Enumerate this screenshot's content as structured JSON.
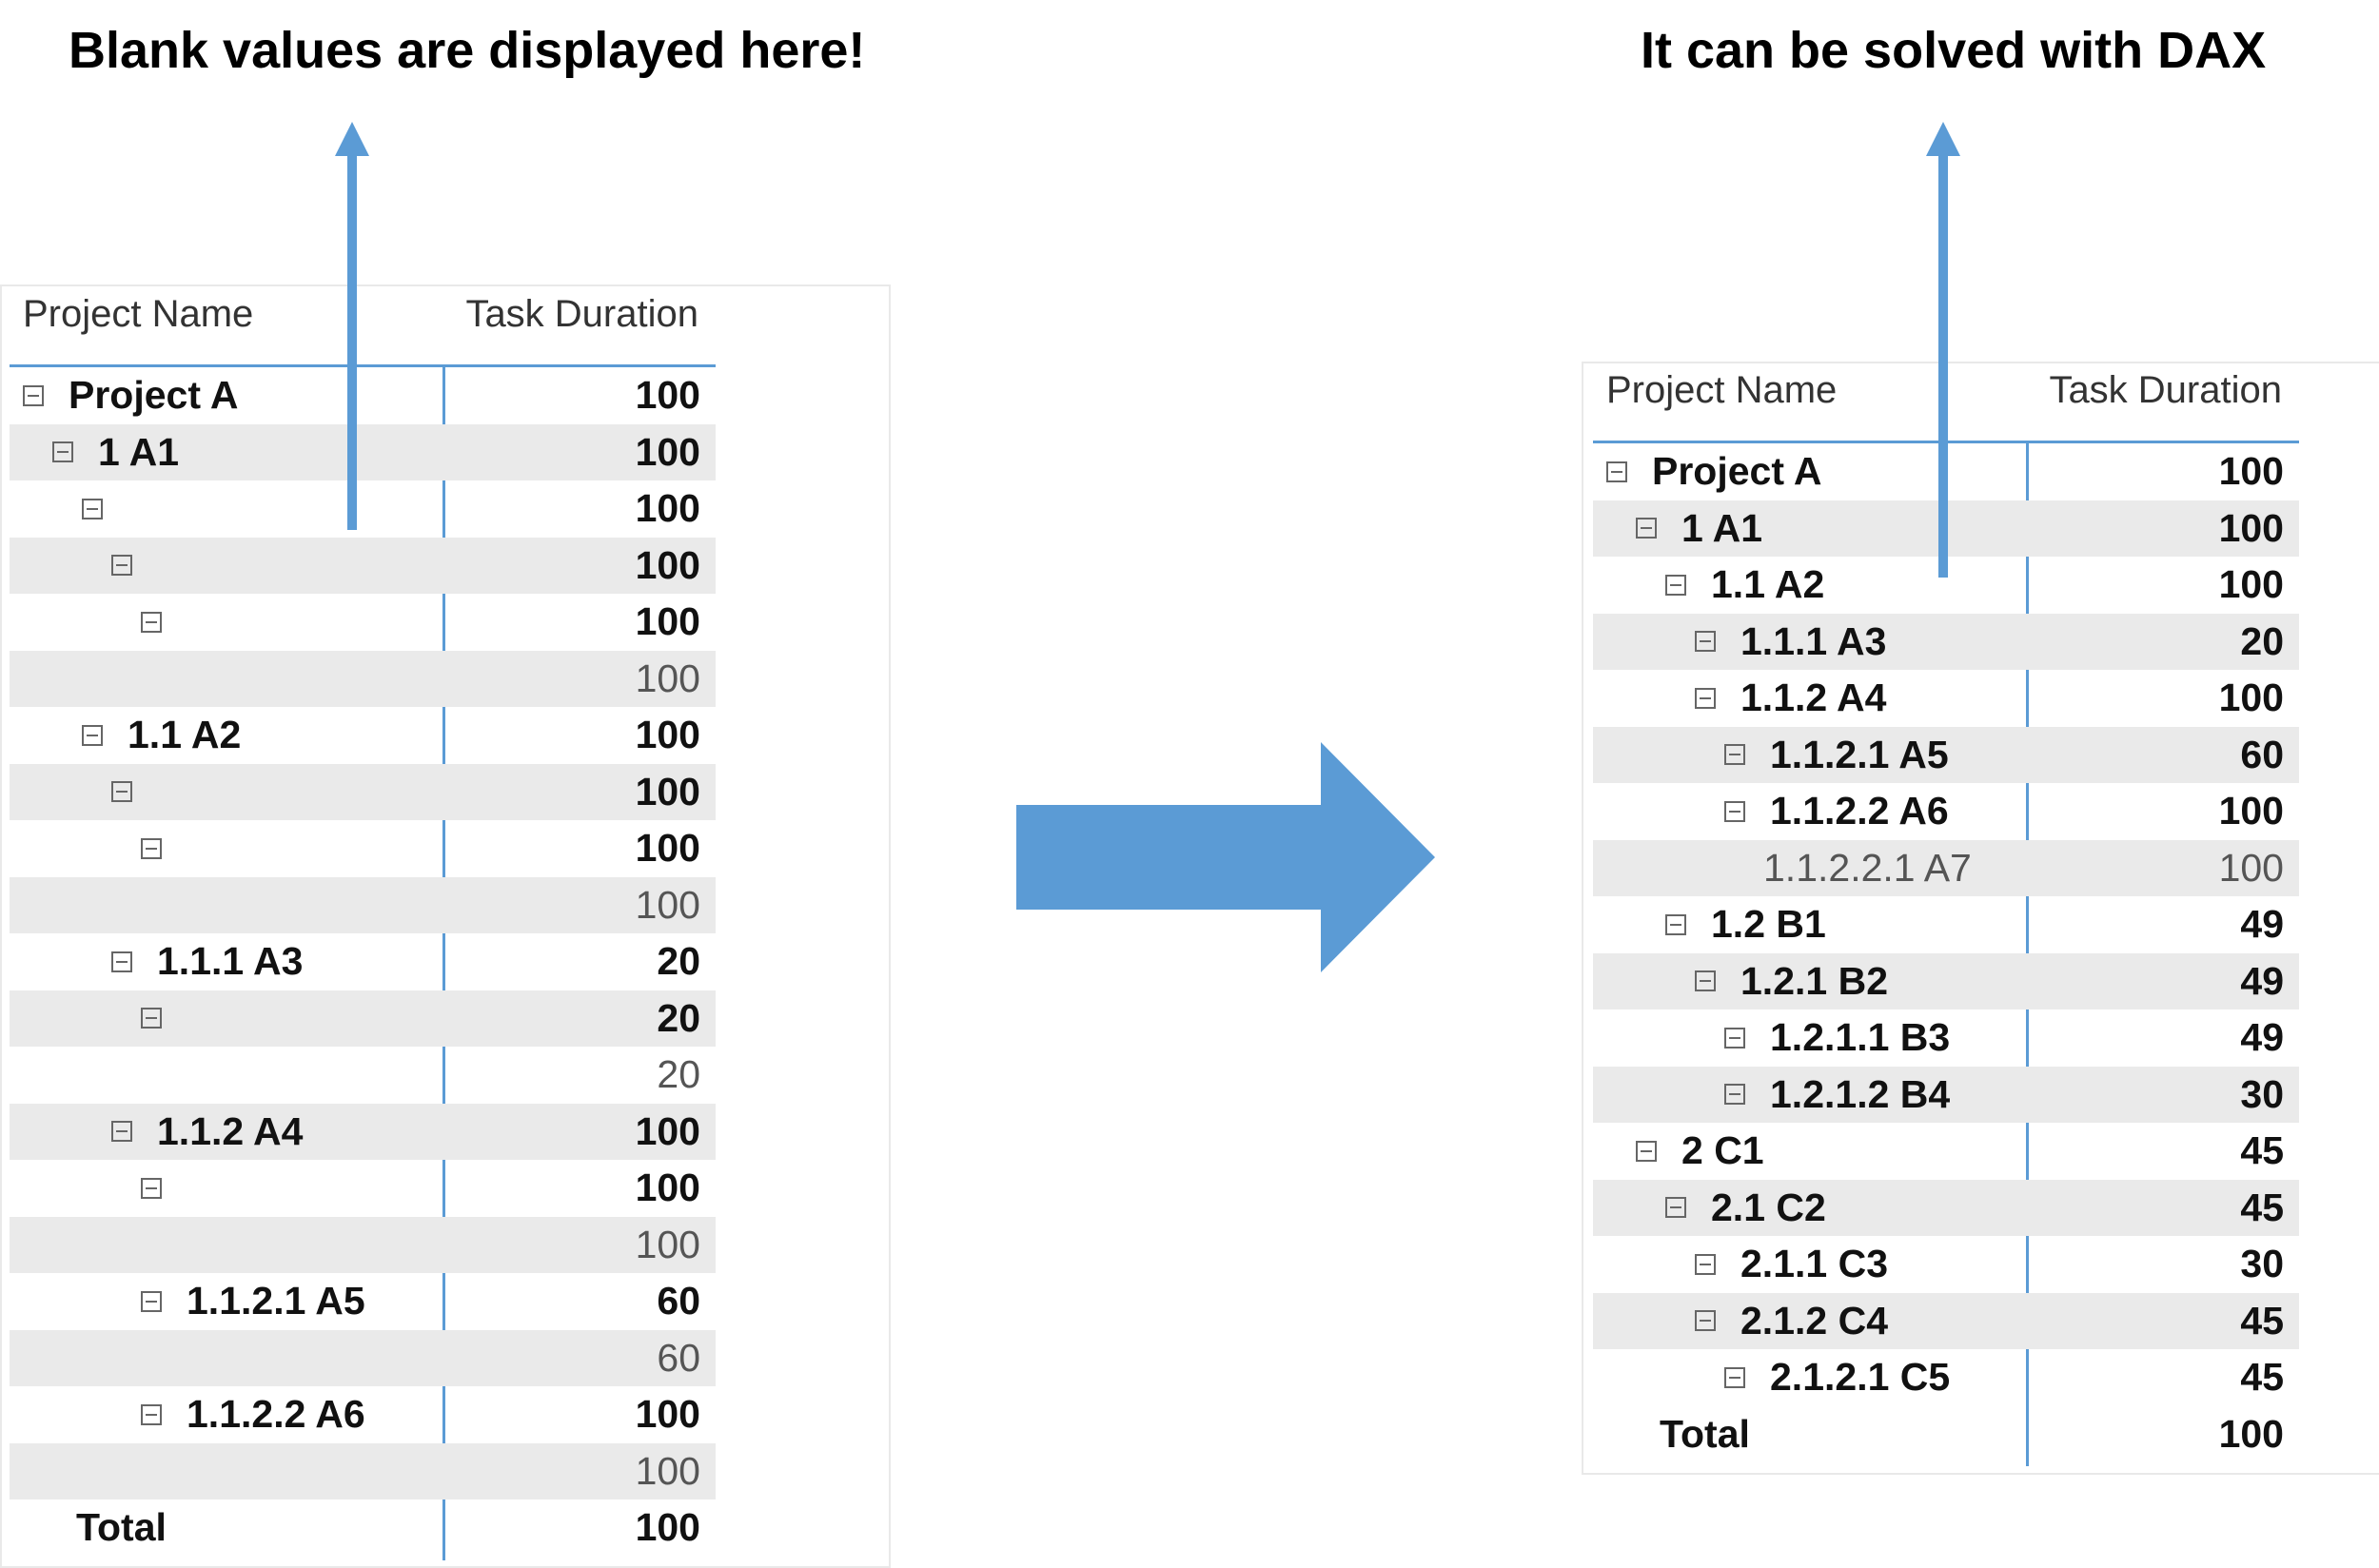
{
  "captions": {
    "left": "Blank values are displayed here!",
    "right": "It can be solved with DAX"
  },
  "colors": {
    "accent": "#5b9bd5",
    "band": "#eaeaea"
  },
  "left_matrix": {
    "col_name": "Project Name",
    "col_value": "Task Duration",
    "rows": [
      {
        "label": "Project A",
        "value": "100",
        "level": 0,
        "toggle": true,
        "bold": true
      },
      {
        "label": "1 A1",
        "value": "100",
        "level": 1,
        "toggle": true,
        "bold": true
      },
      {
        "label": "",
        "value": "100",
        "level": 2,
        "toggle": true,
        "bold": true
      },
      {
        "label": "",
        "value": "100",
        "level": 3,
        "toggle": true,
        "bold": true
      },
      {
        "label": "",
        "value": "100",
        "level": 4,
        "toggle": true,
        "bold": true
      },
      {
        "label": "",
        "value": "100",
        "level": 5,
        "toggle": false,
        "bold": false
      },
      {
        "label": "1.1 A2",
        "value": "100",
        "level": 2,
        "toggle": true,
        "bold": true
      },
      {
        "label": "",
        "value": "100",
        "level": 3,
        "toggle": true,
        "bold": true
      },
      {
        "label": "",
        "value": "100",
        "level": 4,
        "toggle": true,
        "bold": true
      },
      {
        "label": "",
        "value": "100",
        "level": 5,
        "toggle": false,
        "bold": false
      },
      {
        "label": "1.1.1 A3",
        "value": "20",
        "level": 3,
        "toggle": true,
        "bold": true
      },
      {
        "label": "",
        "value": "20",
        "level": 4,
        "toggle": true,
        "bold": true
      },
      {
        "label": "",
        "value": "20",
        "level": 5,
        "toggle": false,
        "bold": false
      },
      {
        "label": "1.1.2 A4",
        "value": "100",
        "level": 3,
        "toggle": true,
        "bold": true
      },
      {
        "label": "",
        "value": "100",
        "level": 4,
        "toggle": true,
        "bold": true
      },
      {
        "label": "",
        "value": "100",
        "level": 5,
        "toggle": false,
        "bold": false
      },
      {
        "label": "1.1.2.1 A5",
        "value": "60",
        "level": 4,
        "toggle": true,
        "bold": true
      },
      {
        "label": "",
        "value": "60",
        "level": 5,
        "toggle": false,
        "bold": false
      },
      {
        "label": "1.1.2.2 A6",
        "value": "100",
        "level": 4,
        "toggle": true,
        "bold": true
      },
      {
        "label": "",
        "value": "100",
        "level": 5,
        "toggle": false,
        "bold": false
      }
    ],
    "total_label": "Total",
    "total_value": "100"
  },
  "right_matrix": {
    "col_name": "Project Name",
    "col_value": "Task Duration",
    "rows": [
      {
        "label": "Project A",
        "value": "100",
        "level": 0,
        "toggle": true,
        "bold": true
      },
      {
        "label": "1 A1",
        "value": "100",
        "level": 1,
        "toggle": true,
        "bold": true
      },
      {
        "label": "1.1 A2",
        "value": "100",
        "level": 2,
        "toggle": true,
        "bold": true
      },
      {
        "label": "1.1.1 A3",
        "value": "20",
        "level": 3,
        "toggle": true,
        "bold": true
      },
      {
        "label": "1.1.2 A4",
        "value": "100",
        "level": 3,
        "toggle": true,
        "bold": true
      },
      {
        "label": "1.1.2.1 A5",
        "value": "60",
        "level": 4,
        "toggle": true,
        "bold": true
      },
      {
        "label": "1.1.2.2 A6",
        "value": "100",
        "level": 4,
        "toggle": true,
        "bold": true
      },
      {
        "label": "1.1.2.2.1 A7",
        "value": "100",
        "level": 5,
        "toggle": false,
        "bold": false
      },
      {
        "label": "1.2 B1",
        "value": "49",
        "level": 2,
        "toggle": true,
        "bold": true
      },
      {
        "label": "1.2.1 B2",
        "value": "49",
        "level": 3,
        "toggle": true,
        "bold": true
      },
      {
        "label": "1.2.1.1 B3",
        "value": "49",
        "level": 4,
        "toggle": true,
        "bold": true
      },
      {
        "label": "1.2.1.2 B4",
        "value": "30",
        "level": 4,
        "toggle": true,
        "bold": true
      },
      {
        "label": "2 C1",
        "value": "45",
        "level": 1,
        "toggle": true,
        "bold": true
      },
      {
        "label": "2.1 C2",
        "value": "45",
        "level": 2,
        "toggle": true,
        "bold": true
      },
      {
        "label": "2.1.1 C3",
        "value": "30",
        "level": 3,
        "toggle": true,
        "bold": true
      },
      {
        "label": "2.1.2 C4",
        "value": "45",
        "level": 3,
        "toggle": true,
        "bold": true
      },
      {
        "label": "2.1.2.1 C5",
        "value": "45",
        "level": 4,
        "toggle": true,
        "bold": true
      }
    ],
    "total_label": "Total",
    "total_value": "100"
  }
}
